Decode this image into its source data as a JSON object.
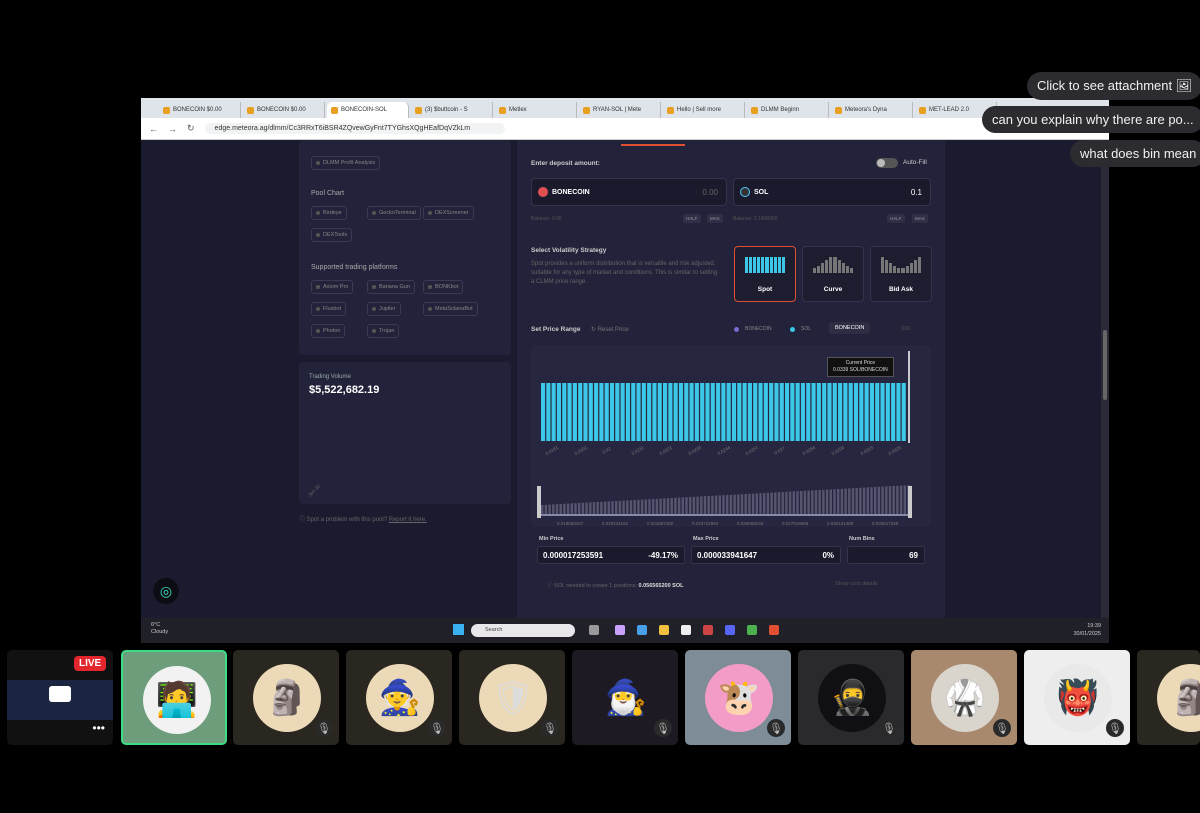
{
  "browser": {
    "tabs": [
      {
        "label": "BONECOIN $0.00"
      },
      {
        "label": "BONECOIN $0.00"
      },
      {
        "label": "BONECOIN-SOL"
      },
      {
        "label": "(3) $buttcoin - S"
      },
      {
        "label": "Metlex"
      },
      {
        "label": "RYAN-SOL | Mete"
      },
      {
        "label": "Hello | Sell more"
      },
      {
        "label": "DLMM Beginn"
      },
      {
        "label": "Meteora's Dyna"
      },
      {
        "label": "MET-LEAD 2.0"
      }
    ],
    "url": "edge.meteora.ag/dlmm/Cc3RRxT6iBSR4ZQvewGyFnt7TYGhsXQgHEafDqVZkLm"
  },
  "left": {
    "profit_chip": "DLMM Profit Analysis",
    "pool_chart_title": "Pool Chart",
    "pool_chart_chips": [
      "Birdeye",
      "GeckoTerminal",
      "DEXScreener",
      "DEXTools"
    ],
    "platforms_title": "Supported trading platforms",
    "platform_chips": [
      "Axiom Pro",
      "Banana Gun",
      "BONKbot",
      "Fluxbot",
      "Jupiter",
      "MetaSolanaBot",
      "Photon",
      "Trojan"
    ],
    "volume_label": "Trading Volume",
    "volume_value": "$5,522,682.19",
    "volume_tick": "Jan 30",
    "report_text": "Spot a problem with this pool?",
    "report_link": "Report it here."
  },
  "deposit": {
    "title": "Enter deposit amount:",
    "autofill": "Auto-Fill",
    "token_a": "BONECOIN",
    "token_a_amount": "0.00",
    "token_b": "SOL",
    "token_b_amount": "0.1",
    "balance_a": "Balance: 0.00",
    "balance_b": "Balance: 0.1406950",
    "half": "HALF",
    "max": "MAX"
  },
  "strategy": {
    "title": "Select Volatility Strategy",
    "description": "Spot provides a uniform distribution that is versatile and risk adjusted, suitable for any type of market and conditions. This is similar to setting a CLMM price range.",
    "options": [
      "Spot",
      "Curve",
      "Bid Ask"
    ]
  },
  "price_range": {
    "title": "Set Price Range",
    "reset": "Reset Price",
    "legend_a": "BONECOIN",
    "legend_b": "SOL",
    "pair_a": "BONECOIN",
    "pair_b": "SOL",
    "current_price_label": "Current Price",
    "current_price_value": "0.0339 SOL/BONECOIN",
    "ticks": [
      "0.0181",
      "0.0191",
      "0.02",
      "0.0211",
      "0.0221",
      "0.0233",
      "0.0244",
      "0.0257",
      "0.027",
      "0.0284",
      "0.0298",
      "0.0313",
      "0.0329"
    ],
    "mini_ticks": [
      "0.018663167",
      "0.020231182",
      "0.021897482",
      "0.023722984",
      "0.025688248",
      "0.027816669",
      "0.030121488",
      "0.032617259"
    ],
    "min_label": "Min Price",
    "min_value": "0.000017253591",
    "min_pct": "-49.17%",
    "max_label": "Max Price",
    "max_value": "0.000033941647",
    "max_pct": "0%",
    "bins_label": "Num Bins",
    "bins_value": "69",
    "sol_needed_label": "SOL needed to create 1 positions:",
    "sol_needed_value": "0.056565200 SOL",
    "cost_details": "Show cost details"
  },
  "taskbar": {
    "temp": "6°C",
    "weather": "Cloudy",
    "search": "Search",
    "time": "19:39",
    "date": "30/01/2025"
  },
  "chat": {
    "attachment": "Click to see attachment",
    "msg1": "can you explain why there are po...",
    "msg2": "what does bin mean"
  },
  "live_badge": "LIVE",
  "colors": {
    "accent": "#3cc8e8",
    "live": "#e3262d",
    "selected_border": "#e05030"
  }
}
